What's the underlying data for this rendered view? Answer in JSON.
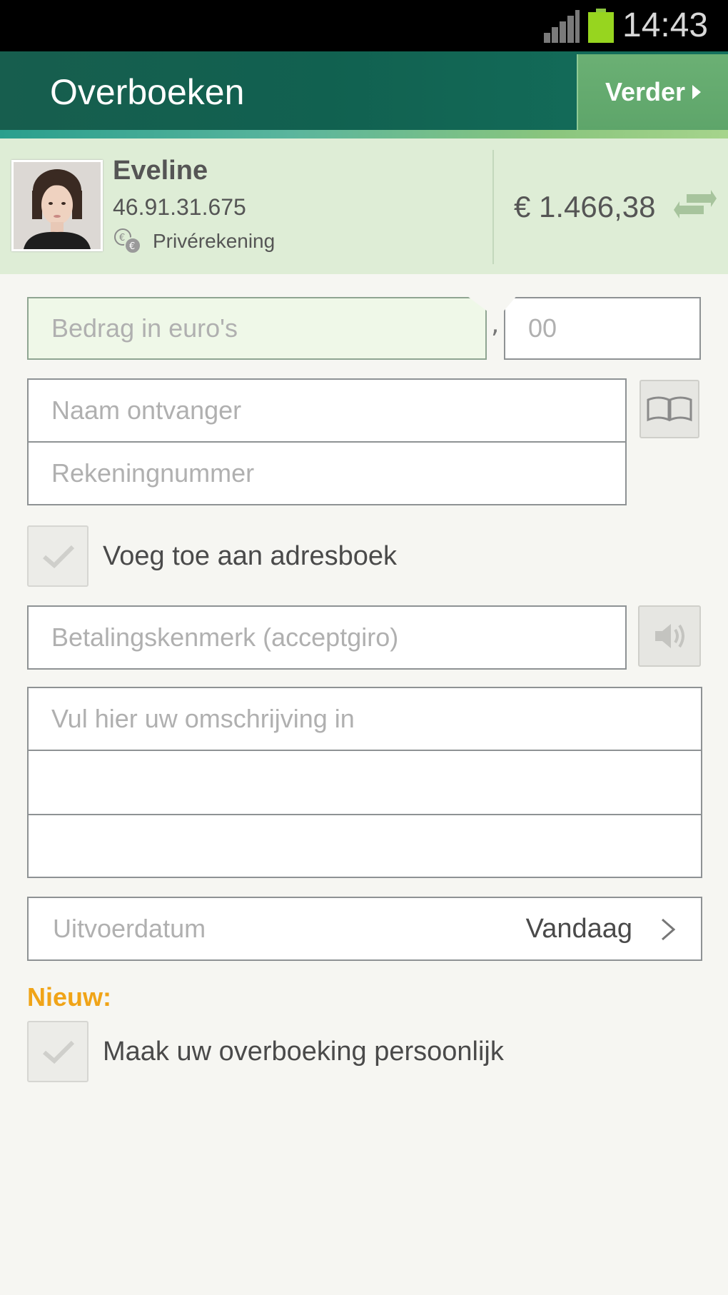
{
  "status_bar": {
    "time": "14:43",
    "icons": [
      "signal-icon",
      "battery-icon"
    ]
  },
  "header": {
    "title": "Overboeken",
    "next_button": "Verder"
  },
  "account": {
    "name": "Eveline",
    "number": "46.91.31.675",
    "type": "Privérekening",
    "balance": "€ 1.466,38"
  },
  "form": {
    "amount_placeholder": "Bedrag in euro's",
    "amount_separator": ",",
    "cents_placeholder": "00",
    "recipient_name_placeholder": "Naam ontvanger",
    "account_number_placeholder": "Rekeningnummer",
    "add_to_addressbook_label": "Voeg toe aan adresboek",
    "payment_reference_placeholder": "Betalingskenmerk (acceptgiro)",
    "description_placeholder": "Vul hier uw omschrijving in",
    "execution_date_label": "Uitvoerdatum",
    "execution_date_value": "Vandaag",
    "new_label": "Nieuw:",
    "personalize_label": "Maak uw overboeking persoonlijk"
  },
  "colors": {
    "header_bg": "#116150",
    "next_button_bg": "#5ea56a",
    "account_bg": "#deedd6",
    "new_label": "#f0a418",
    "battery": "#97d51f"
  }
}
